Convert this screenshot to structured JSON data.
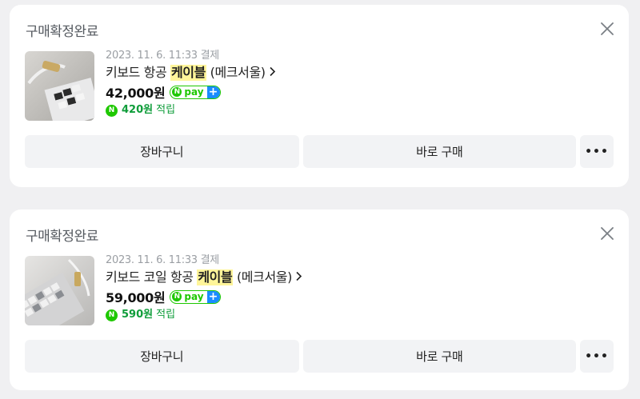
{
  "orders": [
    {
      "status": "구매확정완료",
      "date": "2023. 11. 6. 11:33 결제",
      "title_before": "키보드 항공 ",
      "title_highlight": "케이블",
      "title_after": " (메크서울)",
      "price": "42,000원",
      "npay_label": "pay",
      "npay_n": "N",
      "npay_plus": "+",
      "points_icon": "N",
      "points_amount": "420원",
      "points_label": "적립",
      "cart_label": "장바구니",
      "buy_label": "바로 구매",
      "more_label": "•••"
    },
    {
      "status": "구매확정완료",
      "date": "2023. 11. 6. 11:33 결제",
      "title_before": "키보드 코일 항공 ",
      "title_highlight": "케이블",
      "title_after": " (메크서울)",
      "price": "59,000원",
      "npay_label": "pay",
      "npay_n": "N",
      "npay_plus": "+",
      "points_icon": "N",
      "points_amount": "590원",
      "points_label": "적립",
      "cart_label": "장바구니",
      "buy_label": "바로 구매",
      "more_label": "•••"
    }
  ],
  "colors": {
    "background": "#f0f0f2",
    "card": "#ffffff",
    "naver_green": "#1ec800",
    "points_green": "#0f9d3a",
    "npay_plus_blue": "#1a8cff",
    "highlight": "#fff59a",
    "button_bg": "#f2f3f5"
  },
  "icons": {
    "close": "close-icon",
    "chevron": "chevron-right-icon"
  }
}
